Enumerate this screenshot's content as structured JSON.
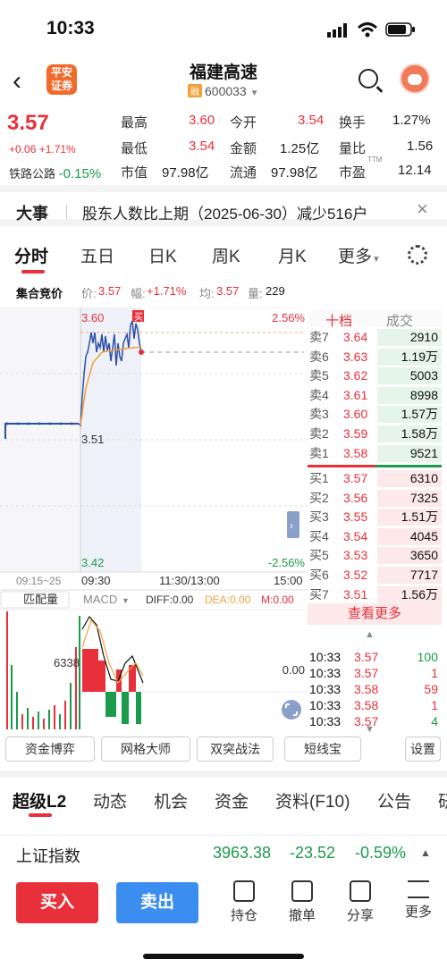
{
  "status": {
    "time": "10:33"
  },
  "header": {
    "logo_line1": "平安",
    "logo_line2": "证券",
    "name": "福建高速",
    "badge": "融",
    "code": "600033"
  },
  "quote": {
    "price": "3.57",
    "change": "+0.06 +1.71%",
    "sector": "铁路公路",
    "sector_change": "-0.15%",
    "high_label": "最高",
    "high": "3.60",
    "open_label": "今开",
    "open": "3.54",
    "turnover_label": "换手",
    "turnover": "1.27%",
    "low_label": "最低",
    "low": "3.54",
    "amount_label": "金额",
    "amount": "1.25亿",
    "volratio_label": "量比",
    "volratio": "1.56",
    "mcap_label": "市值",
    "mcap": "97.98亿",
    "float_label": "流通",
    "float": "97.98亿",
    "pe_label": "市盈",
    "pe_sup": "TTM",
    "pe": "12.14"
  },
  "event": {
    "title": "大事",
    "text": "股东人数比上期（2025-06-30）减少516户"
  },
  "tabs": [
    "分时",
    "五日",
    "日K",
    "周K",
    "月K",
    "更多"
  ],
  "auction": {
    "label": "集合竞价",
    "price_label": "价:",
    "price": "3.57",
    "amp_label": "幅:",
    "amp": "+1.71%",
    "avg_label": "均:",
    "avg": "3.57",
    "vol_label": "量:",
    "vol": "229"
  },
  "chart": {
    "y_high": "3.60",
    "y_mid": "3.51",
    "y_low": "3.42",
    "pct_high": "2.56%",
    "pct_low": "-2.56%",
    "buy_mark": "买",
    "x_labels": [
      "09:15~25",
      "09:30",
      "11:30/13:00",
      "15:00"
    ],
    "match_label": "匹配量",
    "macd_label": "MACD",
    "diff": "DIFF:0.00",
    "dea": "DEA:0.00",
    "m": "M:0.00",
    "vol_mark": "6338",
    "zero": "0.00"
  },
  "book": {
    "header_left": "十档",
    "header_right": "成交",
    "asks": [
      {
        "l": "卖7",
        "p": "3.64",
        "v": "2910"
      },
      {
        "l": "卖6",
        "p": "3.63",
        "v": "1.19万"
      },
      {
        "l": "卖5",
        "p": "3.62",
        "v": "5003"
      },
      {
        "l": "卖4",
        "p": "3.61",
        "v": "8998"
      },
      {
        "l": "卖3",
        "p": "3.60",
        "v": "1.57万"
      },
      {
        "l": "卖2",
        "p": "3.59",
        "v": "1.58万"
      },
      {
        "l": "卖1",
        "p": "3.58",
        "v": "9521"
      }
    ],
    "bids": [
      {
        "l": "买1",
        "p": "3.57",
        "v": "6310"
      },
      {
        "l": "买2",
        "p": "3.56",
        "v": "7325"
      },
      {
        "l": "买3",
        "p": "3.55",
        "v": "1.51万"
      },
      {
        "l": "买4",
        "p": "3.54",
        "v": "4045"
      },
      {
        "l": "买5",
        "p": "3.53",
        "v": "3650"
      },
      {
        "l": "买6",
        "p": "3.52",
        "v": "7717"
      },
      {
        "l": "买7",
        "p": "3.51",
        "v": "1.56万"
      }
    ],
    "more": "查看更多",
    "ticks": [
      {
        "t": "10:33",
        "p": "3.57",
        "v": "100"
      },
      {
        "t": "10:33",
        "p": "3.57",
        "v": "1"
      },
      {
        "t": "10:33",
        "p": "3.58",
        "v": "59"
      },
      {
        "t": "10:33",
        "p": "3.58",
        "v": "1"
      },
      {
        "t": "10:33",
        "p": "3.57",
        "v": "4"
      }
    ]
  },
  "tools": [
    "资金博弈",
    "网格大师",
    "双突战法",
    "短线宝",
    "设置"
  ],
  "subtabs": [
    "超级L2",
    "动态",
    "机会",
    "资金",
    "资料(F10)",
    "公告",
    "研"
  ],
  "index": {
    "name": "上证指数",
    "value": "3963.38",
    "change": "-23.52",
    "pct": "-0.59%"
  },
  "bottom": {
    "buy": "买入",
    "sell": "卖出",
    "items": [
      "持仓",
      "撤单",
      "分享",
      "更多"
    ]
  }
}
